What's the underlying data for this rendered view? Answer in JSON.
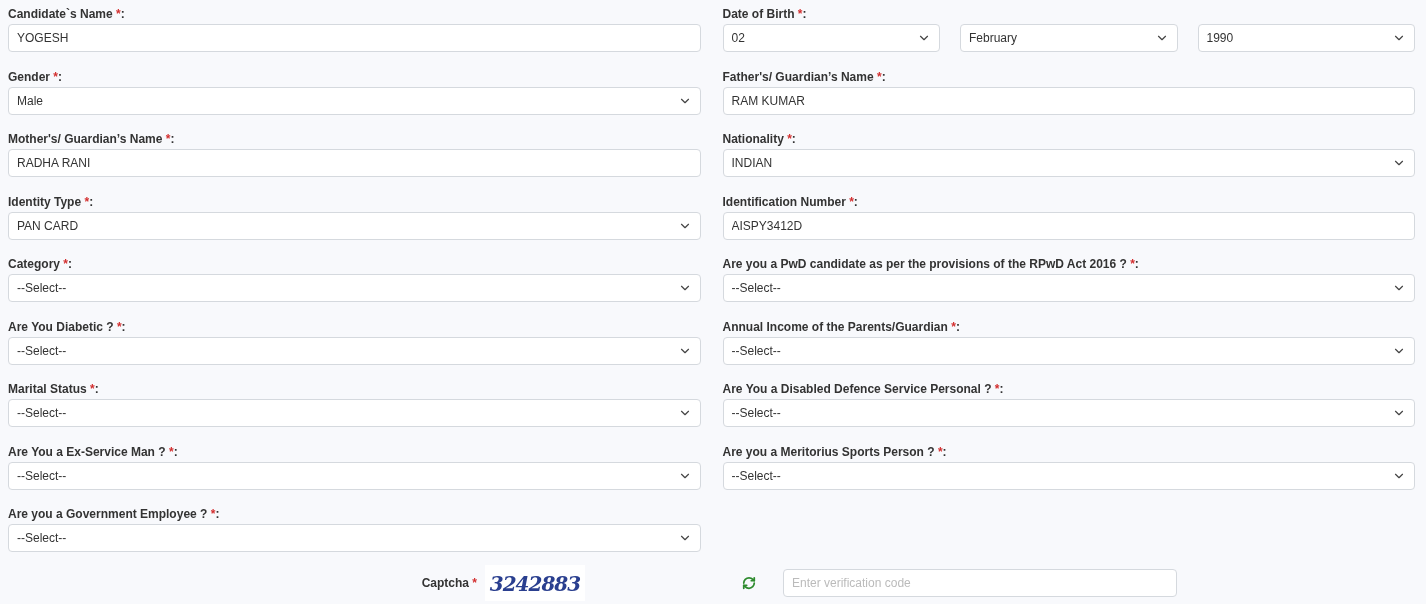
{
  "fields": [
    {
      "kind": "text",
      "label": "Candidate`s Name ",
      "mark": "*",
      "colon": ":",
      "value": "YOGESH"
    },
    {
      "kind": "date",
      "label": "Date of Birth ",
      "mark": "*",
      "colon": ":",
      "parts": [
        {
          "value": "02"
        },
        {
          "value": "February"
        },
        {
          "value": "1990"
        }
      ]
    },
    {
      "kind": "select",
      "label": "Gender ",
      "mark": "*",
      "colon": ":",
      "value": "Male"
    },
    {
      "kind": "text",
      "label": "Father's/ Guardian’s Name ",
      "mark": "*",
      "colon": ":",
      "value": "RAM KUMAR"
    },
    {
      "kind": "text",
      "label": "Mother's/ Guardian’s Name ",
      "mark": "*",
      "colon": ":",
      "value": "RADHA RANI"
    },
    {
      "kind": "select",
      "label": "Nationality ",
      "mark": "*",
      "colon": ":",
      "value": "INDIAN"
    },
    {
      "kind": "select",
      "label": "Identity Type ",
      "mark": "*",
      "colon": ":",
      "value": "PAN CARD"
    },
    {
      "kind": "text",
      "label": "Identification Number ",
      "mark": "*",
      "colon": ":",
      "value": "AISPY3412D"
    },
    {
      "kind": "select",
      "label": "Category ",
      "mark": "*",
      "colon": ":",
      "value": "--Select--"
    },
    {
      "kind": "select",
      "label": "Are you a PwD candidate as per the provisions of the RPwD Act 2016 ? ",
      "mark": "*",
      "colon": ":",
      "value": "--Select--"
    },
    {
      "kind": "select",
      "label": "Are You Diabetic ? ",
      "mark": "*",
      "colon": ":",
      "value": "--Select--"
    },
    {
      "kind": "select",
      "label": "Annual Income of the Parents/Guardian ",
      "mark": "*",
      "colon": ":",
      "value": "--Select--"
    },
    {
      "kind": "select",
      "label": "Marital Status ",
      "mark": "*",
      "colon": ":",
      "value": "--Select--"
    },
    {
      "kind": "select",
      "label": "Are You a Disabled Defence Service Personal ? ",
      "mark": "*",
      "colon": ":",
      "value": "--Select--"
    },
    {
      "kind": "select",
      "label": "Are You a Ex-Service Man ? ",
      "mark": "*",
      "colon": ":",
      "value": "--Select--"
    },
    {
      "kind": "select",
      "label": "Are you a Meritorius Sports Person ? ",
      "mark": "*",
      "colon": ":",
      "value": "--Select--"
    },
    {
      "kind": "select",
      "label": "Are you a Government Employee ? ",
      "mark": "*",
      "colon": ":",
      "value": "--Select--"
    }
  ],
  "captcha": {
    "label": "Captcha ",
    "mark": "*",
    "code": "3242883",
    "placeholder": "Enter verification code"
  }
}
